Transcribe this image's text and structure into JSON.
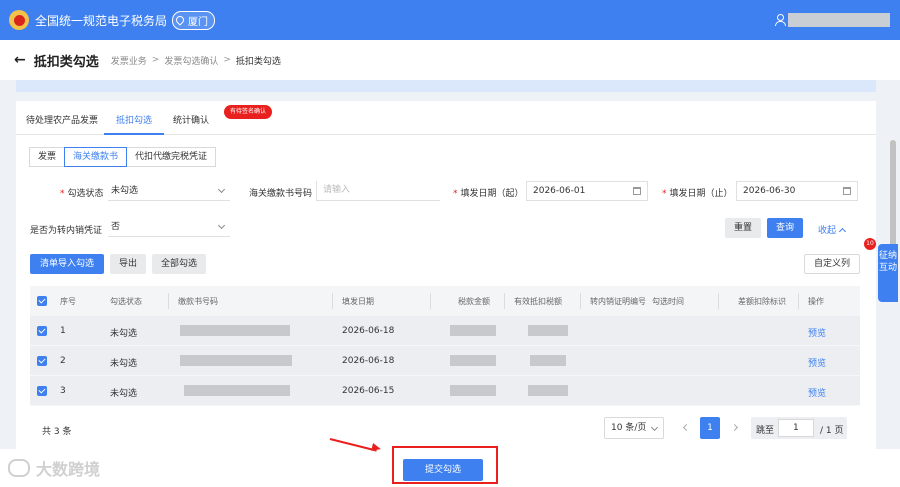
{
  "topbar": {
    "brand": "全国统一规范电子税务局",
    "city": "厦门"
  },
  "header": {
    "back": "←",
    "title": "抵扣类勾选",
    "breadcrumb": [
      "发票业务",
      "发票勾选确认",
      "抵扣类勾选"
    ],
    "sep": ">"
  },
  "tabs": [
    {
      "label": "待处理农产品发票"
    },
    {
      "label": "抵扣勾选"
    },
    {
      "label": "统计确认"
    }
  ],
  "tab_badge": "有待签名确认",
  "subtabs": [
    {
      "label": "发票"
    },
    {
      "label": "海关缴款书"
    },
    {
      "label": "代扣代缴完税凭证"
    }
  ],
  "filters": {
    "status_label": "勾选状态",
    "status_value": "未勾选",
    "bill_no_label": "海关缴款书号码",
    "bill_no_placeholder": "请输入",
    "date_start_label": "填发日期（起）",
    "date_start_value": "2026-06-01",
    "date_end_label": "填发日期（止）",
    "date_end_value": "2026-06-30",
    "transfer_label": "是否为转内销凭证",
    "transfer_value": "否",
    "required_mark": "*"
  },
  "buttons": {
    "reset": "重置",
    "query": "查询",
    "collapse": "收起",
    "import": "清单导入勾选",
    "export": "导出",
    "select_all": "全部勾选",
    "custom_cols": "自定义列",
    "submit": "提交勾选"
  },
  "table": {
    "headers": [
      "序号",
      "勾选状态",
      "缴款书号码",
      "填发日期",
      "税款金额",
      "有效抵扣税额",
      "转内销证明编号",
      "勾选时间",
      "差额扣除标识",
      "操作"
    ],
    "rows": [
      {
        "no": "1",
        "status": "未勾选",
        "date": "2026-06-18",
        "action": "预览"
      },
      {
        "no": "2",
        "status": "未勾选",
        "date": "2026-06-18",
        "action": "预览"
      },
      {
        "no": "3",
        "status": "未勾选",
        "date": "2026-06-15",
        "action": "预览"
      }
    ]
  },
  "pager": {
    "total": "共 3 条",
    "page_size": "10 条/页",
    "current": "1",
    "jump_label": "跳至",
    "jump_value": "1",
    "total_pages": "/ 1 页"
  },
  "float": {
    "label": "征纳互动",
    "badge": "10"
  },
  "watermark": "大数跨境",
  "colors": {
    "primary": "#3e80f0",
    "danger": "#e8201e"
  }
}
